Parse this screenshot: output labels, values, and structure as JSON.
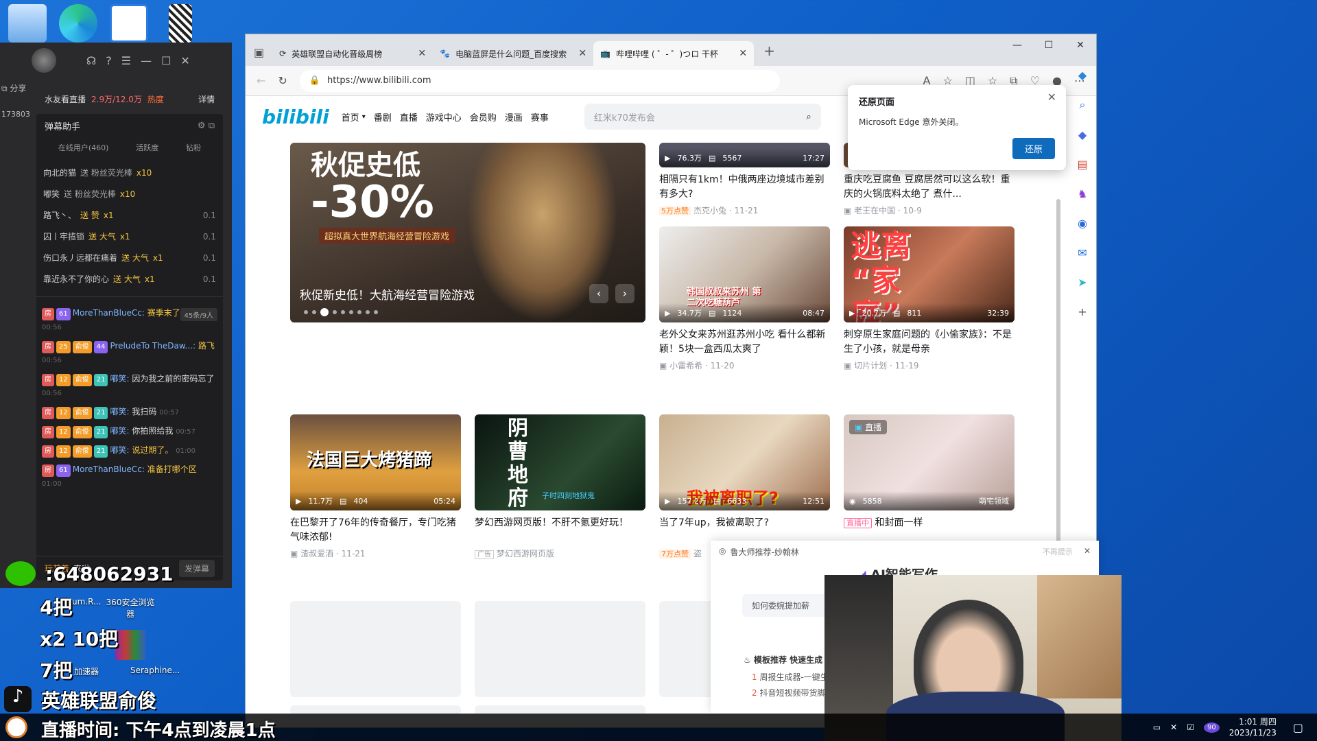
{
  "desktop": {
    "icons": [
      {
        "name": "this-pc"
      },
      {
        "name": "edge"
      },
      {
        "name": "app-blue"
      },
      {
        "name": "qr-file"
      }
    ],
    "labels": {
      "360": "360安全浏览器",
      "accel": "加速器",
      "sera": "Seraphine..."
    }
  },
  "live": {
    "share": "分享",
    "room_id": "173803",
    "room_title": "水友看直播",
    "count": "2.9万/12.0万",
    "hot": "热度",
    "detail": "详情",
    "assistant": "弹幕助手",
    "tabs": [
      "在线用户(460)",
      "活跃度",
      "钻粉"
    ],
    "gifts": [
      {
        "user": "向北的猫",
        "action": "送 粉丝荧光棒",
        "x": "x10",
        "amt": ""
      },
      {
        "user": "嘟笑",
        "action": "送 粉丝荧光棒",
        "x": "x10",
        "amt": ""
      },
      {
        "user": "路飞丶、",
        "action": "送 赞",
        "x": "x1",
        "amt": "0.1"
      },
      {
        "user": "囚丨牢揽锁",
        "action": "送 大气",
        "x": "x1",
        "amt": "0.1"
      },
      {
        "user": "伤口永丿远都在痛着",
        "action": "送 大气",
        "x": "x1",
        "amt": "0.1"
      },
      {
        "user": "靠近永不了你的心",
        "action": "送 大气",
        "x": "x1",
        "amt": "0.1"
      }
    ],
    "count_label": "45条/9人",
    "chats": [
      {
        "lv": "61",
        "name": "MoreThanBlueCc:",
        "text": "赛季末了",
        "ts": "00:56"
      },
      {
        "lv": "25",
        "fan": "俞俊",
        "lv2": "44",
        "name": "PreludeTo TheDaw...:",
        "text": "路飞",
        "ts": "00:56"
      },
      {
        "lv": "12",
        "fan": "俞俊",
        "lv2": "21",
        "name": "嘟笑:",
        "text": "因为我之前的密码忘了",
        "ts": "00:56"
      },
      {
        "lv": "12",
        "fan": "俞俊",
        "lv2": "21",
        "name": "嘟笑:",
        "text": "我扫码",
        "ts": "00:57"
      },
      {
        "lv": "12",
        "fan": "俞俊",
        "lv2": "21",
        "name": "嘟笑:",
        "text": "你拍照给我",
        "ts": "00:57"
      },
      {
        "lv": "12",
        "fan": "俞俊",
        "lv2": "21",
        "name": "嘟笑:",
        "text": "说过期了。",
        "ts": "01:00"
      },
      {
        "lv": "61",
        "name": "MoreThanBlueCc:",
        "text": "准备打哪个区",
        "ts": "01:00"
      }
    ],
    "enter_user": "玩其善",
    "enter_text": "来啦",
    "send": "发弹幕"
  },
  "overlay": {
    "wechat": ":648062931",
    "line1": "4把",
    "line2": "x2 10把",
    "line3": "7把",
    "douyin": "英雄联盟俞俊",
    "time": "直播时间: 下午4点到凌晨1点",
    "hum": "um.R..."
  },
  "browser": {
    "tabs": [
      {
        "label": "英雄联盟自动化晋级周榜"
      },
      {
        "label": "电脑蓝屏是什么问题_百度搜索"
      },
      {
        "label": "哔哩哔哩 ( ゜- ゜)つロ 干杯~-bilib"
      }
    ],
    "url": "https://www.bilibili.com"
  },
  "bili": {
    "logo": "bilibili",
    "nav": [
      "首页",
      "番剧",
      "直播",
      "游戏中心",
      "会员购",
      "漫画",
      "赛事"
    ],
    "search_placeholder": "红米k70发布会",
    "banner": {
      "title": "秋促新史低！大航海经营冒险游戏",
      "big": "秋促史低",
      "pct": "-30%",
      "sub": "超拟真大世界航海经营冒险游戏"
    },
    "cards": [
      {
        "views": "76.3万",
        "danmaku": "5567",
        "dur": "17:27",
        "title": "相隔只有1km！中俄两座边境城市差别有多大?",
        "tag": "5万点赞",
        "up": "杰克小兔",
        "date": "11-21"
      },
      {
        "views": "",
        "danmaku": "",
        "dur": "",
        "title": "重庆吃豆腐鱼 豆腐居然可以这么软！重庆的火锅底料太绝了 煮什...",
        "tag": "",
        "up": "老王在中国",
        "date": "10-9"
      },
      {
        "views": "34.7万",
        "danmaku": "1124",
        "dur": "08:47",
        "title": "老外父女来苏州逛苏州小吃 看什么都新颖！5块一盒西瓜太爽了",
        "tag": "",
        "up": "小雷希希",
        "date": "11-20",
        "cap": "韩国叔叔来苏州 第二次吃糖葫芦"
      },
      {
        "views": "20.7万",
        "danmaku": "811",
        "dur": "32:39",
        "title": "刺穿原生家庭问题的《小偷家族》：不是生了小孩，就是母亲",
        "tag": "",
        "up": "切片计划",
        "date": "11-19",
        "cap": "逃离 “家庭”"
      },
      {
        "views": "11.7万",
        "danmaku": "404",
        "dur": "05:24",
        "title": "在巴黎开了76年的传奇餐厅，专门吃猪气味浓郁!",
        "tag": "",
        "up": "渣叔爱酒",
        "date": "11-21",
        "cap": "法国巨大烤猪蹄"
      },
      {
        "views": "",
        "danmaku": "",
        "dur": "",
        "title": "梦幻西游网页版！不肝不氪更好玩！",
        "tag": "广告",
        "up": "梦幻西游网页版",
        "date": "",
        "cap": "阴曹地府",
        "cap2": "子时四刻地狱鬼"
      },
      {
        "views": "157.2万",
        "danmaku": "6633",
        "dur": "12:51",
        "title": "当了7年up，我被离职了?",
        "tag": "7万点赞",
        "up": "盗",
        "date": "",
        "cap": "我被离职了?"
      },
      {
        "views": "5858",
        "danmaku": "",
        "dur": "萌宅领域",
        "title": "和封面一样",
        "tag": "直播中",
        "up": "",
        "date": "",
        "live": "直播"
      }
    ]
  },
  "restore": {
    "title": "还原页面",
    "text": "Microsoft Edge 意外关闭。",
    "button": "还原"
  },
  "ai_ad": {
    "source": "鲁大师推荐-妙翰林",
    "dismiss": "不再提示",
    "title": "AI智能写作",
    "prompt": "如何委婉提加薪",
    "rec": "模板推荐 快速生成",
    "items": [
      "周报生成器-一键生",
      "抖音短视频带货脚"
    ]
  },
  "taskbar": {
    "time": "1:01 周四",
    "date": "2023/11/23",
    "badge": "90"
  }
}
